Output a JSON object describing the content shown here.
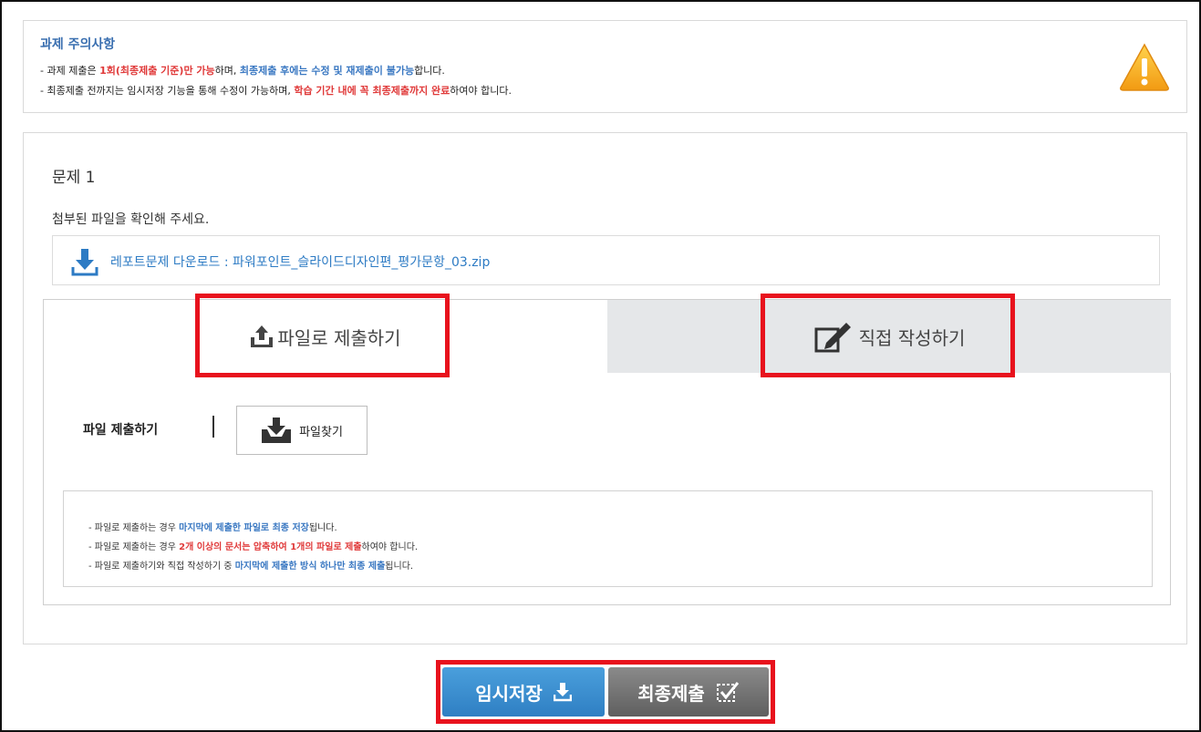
{
  "notice": {
    "title": "과제 주의사항",
    "line1": {
      "p1": "- 과제 제출은 ",
      "p2": "1회(최종제출 기준)만 가능",
      "p3": "하며, ",
      "p4": "최종제출 후에는 수정 및 재제출이 불가능",
      "p5": "합니다."
    },
    "line2": {
      "p1": "- 최종제출 전까지는 임시저장 기능을 통해 수정이 가능하며, ",
      "p2": "학습 기간 내에 꼭 최종제출까지 완료",
      "p3": "하여야 합니다."
    },
    "icon": "warning-icon"
  },
  "question": {
    "title": "문제 1",
    "description": "첨부된 파일을 확인해 주세요.",
    "download_text": "레포트문제 다운로드 : 파워포인트_슬라이드디자인편_평가문항_03.zip",
    "download_icon": "download-icon"
  },
  "tabs": {
    "file_label": "파일로 제출하기",
    "direct_label": "직접 작성하기",
    "file_icon": "upload-icon",
    "direct_icon": "edit-icon"
  },
  "file_submit": {
    "label": "파일 제출하기",
    "button": "파일찾기"
  },
  "info": {
    "line1": {
      "p1": "- 파일로 제출하는 경우 ",
      "p2": "마지막에 제출한 파일로 최종 저장",
      "p3": "됩니다."
    },
    "line2": {
      "p1": "- 파일로 제출하는 경우 ",
      "p2": "2개 이상의 문서는 압축하여 1개의 파일로 제출",
      "p3": "하여야 합니다."
    },
    "line3": {
      "p1": "- 파일로 제출하기와 직접 작성하기 중 ",
      "p2": "마지막에 제출한 방식 하나만 최종 제출",
      "p3": "됩니다."
    }
  },
  "buttons": {
    "save": "임시저장",
    "final": "최종제출"
  },
  "colors": {
    "accent_blue": "#2d7bc4",
    "highlight_red": "#e03a3a",
    "outline_red": "#e8121d",
    "save_blue": "#3b8fd2",
    "final_gray": "#6f6f6f",
    "tab_inactive": "#e5e7e9"
  }
}
